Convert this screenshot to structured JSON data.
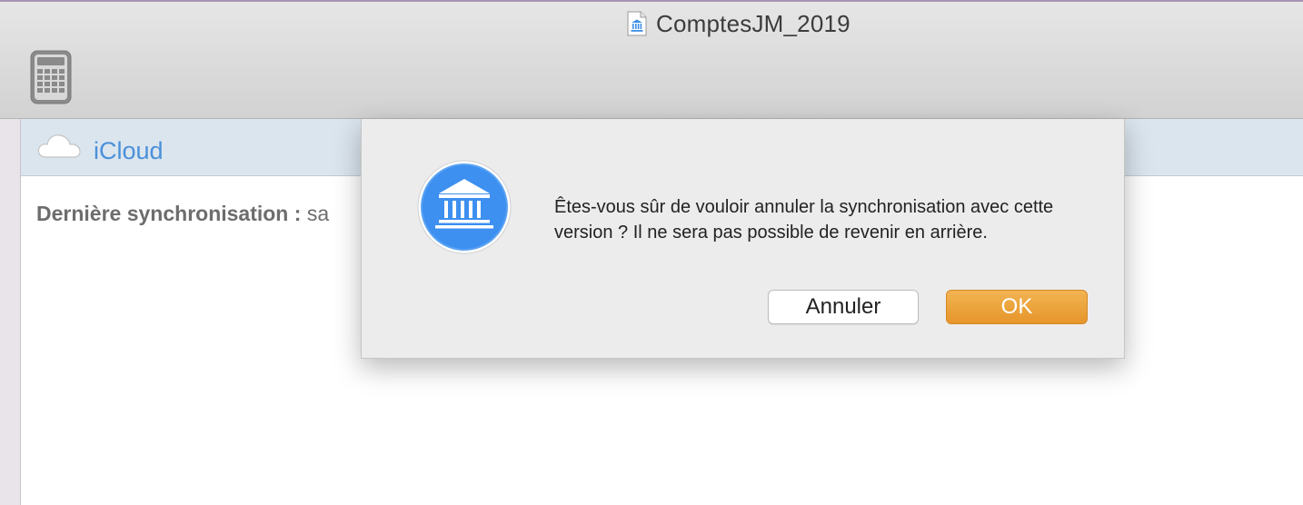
{
  "window": {
    "title": "ComptesJM_2019",
    "document_icon": "bank-document-icon",
    "toolbar_icon": "calculator-icon"
  },
  "icloud_section": {
    "icon": "cloud-icon",
    "label": "iCloud",
    "last_sync_label": "Dernière synchronisation :",
    "last_sync_value": "sa"
  },
  "dialog": {
    "icon": "bank-building-icon",
    "message": "Êtes-vous sûr de vouloir annuler la synchronisation avec cette version ? Il ne sera pas possible de revenir en arrière.",
    "cancel_label": "Annuler",
    "ok_label": "OK"
  },
  "colors": {
    "accent_blue": "#4a90d9",
    "ok_button": "#eba13c",
    "icloud_bar": "#dbe5ee"
  }
}
